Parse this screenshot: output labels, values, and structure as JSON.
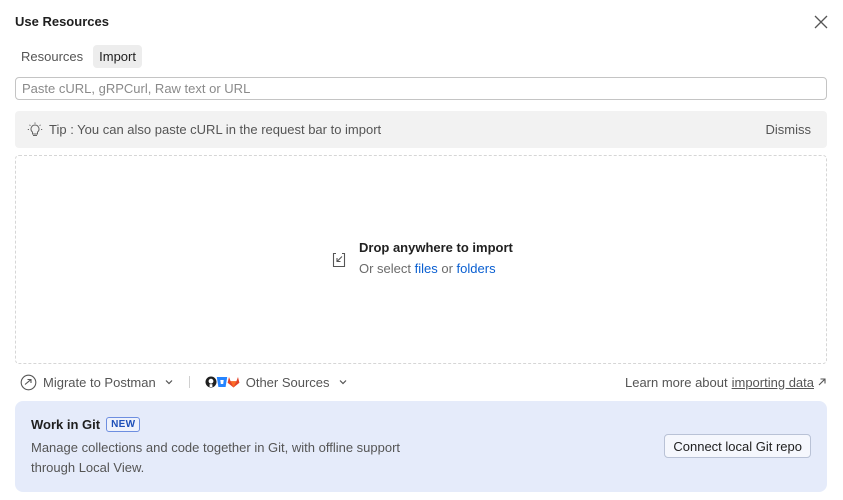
{
  "dialog": {
    "title": "Use Resources"
  },
  "tabs": [
    {
      "label": "Resources",
      "active": false
    },
    {
      "label": "Import",
      "active": true
    }
  ],
  "import_input": {
    "placeholder": "Paste cURL, gRPCurl, Raw text or URL",
    "value": ""
  },
  "tip": {
    "text": "Tip : You can also paste cURL in the request bar to import",
    "dismiss_label": "Dismiss"
  },
  "dropzone": {
    "title": "Drop anywhere to import",
    "prefix": "Or select ",
    "files_link": "files",
    "middle": " or ",
    "folders_link": "folders"
  },
  "bottom_bar": {
    "migrate_label": "Migrate to Postman",
    "other_sources_label": "Other Sources",
    "learn_prefix": "Learn more about",
    "learn_link": "importing data"
  },
  "git_card": {
    "title": "Work in Git",
    "badge": "NEW",
    "description": "Manage collections and code together in Git, with offline support through Local View.",
    "button_label": "Connect local Git repo"
  },
  "colors": {
    "accent_link": "#0a5fd1",
    "git_card_bg": "#e5ebfa",
    "gitlab_orange": "#e24329",
    "bitbucket_blue": "#2684ff"
  }
}
